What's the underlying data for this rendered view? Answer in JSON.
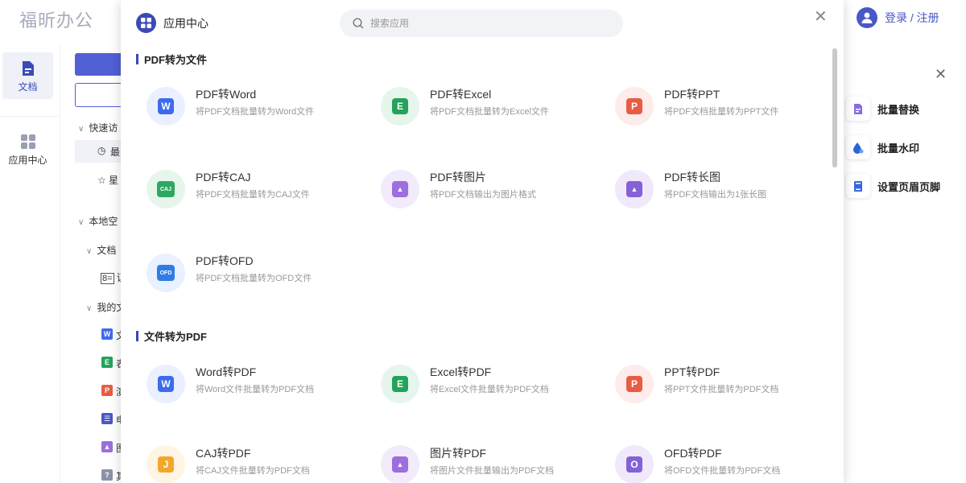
{
  "app": {
    "logo": "福昕办公"
  },
  "rail": [
    {
      "label": "文档",
      "icon": "document-icon",
      "active": true
    },
    {
      "label": "应用中心",
      "icon": "grid-icon",
      "active": false
    }
  ],
  "tree": {
    "quick": "快速访",
    "recent": "最",
    "star": "星",
    "local": "本地空",
    "docs": "文档",
    "id_item": "证",
    "mine": "我的文",
    "files": [
      {
        "letter": "W",
        "color": "#3d6bef",
        "text": "文"
      },
      {
        "letter": "E",
        "color": "#23a35b",
        "text": "表"
      },
      {
        "letter": "P",
        "color": "#e85c43",
        "text": "演"
      },
      {
        "letter": "☰",
        "color": "#4a57c6",
        "text": "电"
      },
      {
        "letter": "▲",
        "color": "#9c6ede",
        "text": "图"
      },
      {
        "letter": "?",
        "color": "#8c93a6",
        "text": "其"
      }
    ]
  },
  "header": {
    "login": "登录 / 注册"
  },
  "right_panel": {
    "tools": [
      {
        "label": "批量替换",
        "icon": "replace-icon",
        "color": "#8b6be2"
      },
      {
        "label": "批量水印",
        "icon": "watermark-icon",
        "color": "#2a64d6"
      },
      {
        "label": "设置页眉页脚",
        "icon": "header-footer-icon",
        "color": "#3a65d9"
      }
    ]
  },
  "modal": {
    "title": "应用中心",
    "search_placeholder": "搜索应用",
    "sections": [
      {
        "title": "PDF转为文件",
        "items": [
          {
            "name": "PDF转Word",
            "desc": "将PDF文档批量转为Word文件",
            "letter": "W",
            "color": "#3d6bef",
            "bg": "#eaf0ff",
            "icon": "pdf-to-word-icon"
          },
          {
            "name": "PDF转Excel",
            "desc": "将PDF文档批量转为Excel文件",
            "letter": "E",
            "color": "#23a35b",
            "bg": "#e6f6ec",
            "icon": "pdf-to-excel-icon"
          },
          {
            "name": "PDF转PPT",
            "desc": "将PDF文档批量转为PPT文件",
            "letter": "P",
            "color": "#e85c43",
            "bg": "#fdecea",
            "icon": "pdf-to-ppt-icon"
          },
          {
            "name": "PDF转CAJ",
            "desc": "将PDF文档批量转为CAJ文件",
            "letter": "CAJ",
            "color": "#2ea861",
            "bg": "#e6f6ec",
            "icon": "pdf-to-caj-icon"
          },
          {
            "name": "PDF转图片",
            "desc": "将PDF文档输出为图片格式",
            "letter": "▲",
            "color": "#9c6ede",
            "bg": "#f1ebfb",
            "icon": "pdf-to-image-icon"
          },
          {
            "name": "PDF转长图",
            "desc": "将PDF文档输出为1张长图",
            "letter": "▲",
            "color": "#8560d6",
            "bg": "#efe9fb",
            "icon": "pdf-to-long-image-icon"
          },
          {
            "name": "PDF转OFD",
            "desc": "将PDF文档批量转为OFD文件",
            "letter": "OFD",
            "color": "#2f7ce6",
            "bg": "#e8f1fd",
            "icon": "pdf-to-ofd-icon"
          }
        ]
      },
      {
        "title": "文件转为PDF",
        "items": [
          {
            "name": "Word转PDF",
            "desc": "将Word文件批量转为PDF文档",
            "letter": "W",
            "color": "#3d6bef",
            "bg": "#eaf0ff",
            "icon": "word-to-pdf-icon"
          },
          {
            "name": "Excel转PDF",
            "desc": "将Excel文件批量转为PDF文档",
            "letter": "E",
            "color": "#23a35b",
            "bg": "#e6f6ec",
            "icon": "excel-to-pdf-icon"
          },
          {
            "name": "PPT转PDF",
            "desc": "将PPT文件批量转为PDF文档",
            "letter": "P",
            "color": "#e85c43",
            "bg": "#fdecea",
            "icon": "ppt-to-pdf-icon"
          },
          {
            "name": "CAJ转PDF",
            "desc": "将CAJ文件批量转为PDF文档",
            "letter": "J",
            "color": "#f3a72a",
            "bg": "#fef5e4",
            "icon": "caj-to-pdf-icon"
          },
          {
            "name": "图片转PDF",
            "desc": "将图片文件批量输出为PDF文档",
            "letter": "▲",
            "color": "#9c6ede",
            "bg": "#f1ebfb",
            "icon": "image-to-pdf-icon"
          },
          {
            "name": "OFD转PDF",
            "desc": "将OFD文件批量转为PDF文档",
            "letter": "O",
            "color": "#8560d6",
            "bg": "#efe9fb",
            "icon": "ofd-to-pdf-icon"
          }
        ]
      }
    ]
  }
}
